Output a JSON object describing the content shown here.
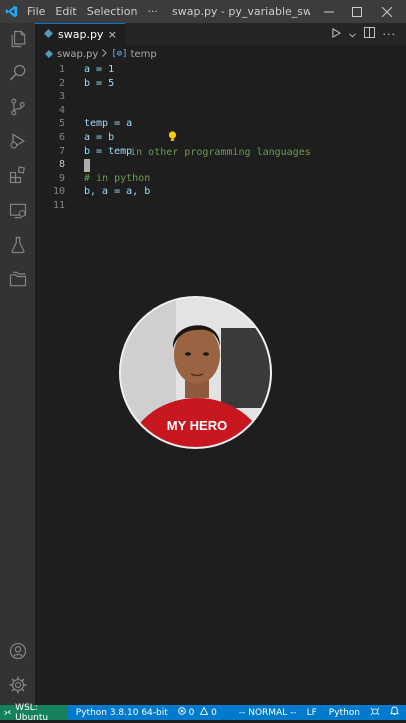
{
  "titlebar": {
    "menu": [
      "File",
      "Edit",
      "Selection",
      "···"
    ],
    "title": "swap.py - py_variable_swapping [..."
  },
  "tab": {
    "filename": "swap.py",
    "close": "×"
  },
  "breadcrumbs": {
    "file": "swap.py",
    "symbol": "temp"
  },
  "editor": {
    "lines": [
      {
        "num": "1",
        "text": "a = 1"
      },
      {
        "num": "2",
        "text": "b = 5"
      },
      {
        "num": "3",
        "text": ""
      },
      {
        "num": "4",
        "text": "in other programming languages"
      },
      {
        "num": "5",
        "text": "temp = a"
      },
      {
        "num": "6",
        "text": "a = b"
      },
      {
        "num": "7",
        "text": "b = temp"
      },
      {
        "num": "8",
        "text": ""
      },
      {
        "num": "9",
        "text": "# in python"
      },
      {
        "num": "10",
        "text": "b, a = a, b"
      },
      {
        "num": "11",
        "text": ""
      }
    ]
  },
  "webcam": {
    "shirt_text": "MY HERO"
  },
  "statusbar": {
    "remote": "WSL: Ubuntu",
    "interpreter": "Python 3.8.10 64-bit",
    "errors": "0",
    "warnings": "0",
    "vim_mode": "-- NORMAL --",
    "eol": "LF",
    "language": "Python"
  },
  "colors": {
    "accent": "#007acc",
    "remote": "#16825d",
    "comment": "#6a9955",
    "variable": "#9cdcfe",
    "number": "#b5cea8"
  }
}
